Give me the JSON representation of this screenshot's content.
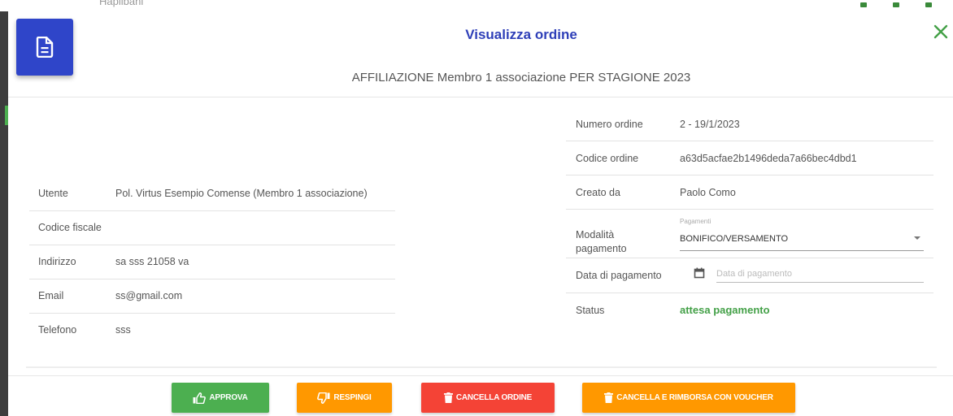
{
  "background": {
    "peek_text": "Haplibani"
  },
  "modal": {
    "title": "Visualizza ordine",
    "subtitle": "AFFILIAZIONE Membro 1 associazione PER STAGIONE 2023",
    "doc_icon": "document-icon",
    "close_icon": "close-icon"
  },
  "customer": {
    "rows": [
      {
        "label": "Utente",
        "value": "Pol. Virtus Esempio Comense (Membro 1 associazione)"
      },
      {
        "label": "Codice fiscale",
        "value": ""
      },
      {
        "label": "Indirizzo",
        "value": "sa sss 21058 va"
      },
      {
        "label": "Email",
        "value": "ss@gmail.com"
      },
      {
        "label": "Telefono",
        "value": "sss"
      }
    ]
  },
  "order": {
    "numero_label": "Numero ordine",
    "numero_value": "2 - 19/1/2023",
    "codice_label": "Codice ordine",
    "codice_value": "a63d5acfae2b1496deda7a66bec4dbd1",
    "creato_label": "Creato da",
    "creato_value": "Paolo Como",
    "modalita_label": "Modalità pagamento",
    "modalita_small": "Pagamenti",
    "modalita_value": "BONIFICO/VERSAMENTO",
    "data_label": "Data di pagamento",
    "data_placeholder": "Data di pagamento",
    "status_label": "Status",
    "status_value": "attesa pagamento"
  },
  "actions": {
    "approve": "APPROVA",
    "reject": "RESPINGI",
    "cancel": "CANCELLA ORDINE",
    "voucher": "CANCELLA E RIMBORSA CON VOUCHER"
  },
  "colors": {
    "primary": "#2f45c9",
    "success": "#4caf50",
    "warning": "#ff9800",
    "danger": "#f44336"
  }
}
